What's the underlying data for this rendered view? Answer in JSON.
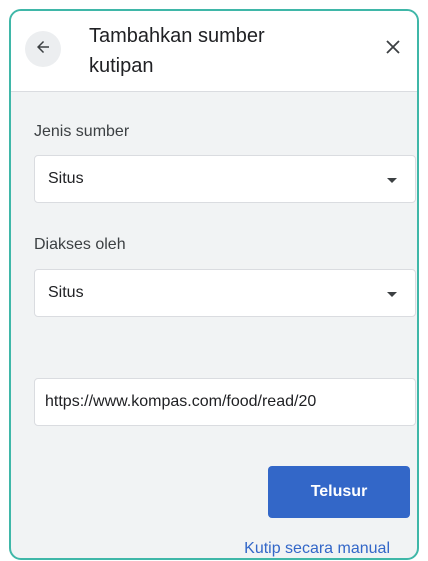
{
  "dialog": {
    "title": "Tambahkan sumber kutipan",
    "icons": {
      "back": "arrow-left-icon",
      "close": "close-icon",
      "dropdown": "caret-down-icon"
    },
    "colors": {
      "accent": "#3367c8",
      "frame_border": "#3fb7a8",
      "panel_bg": "#f1f3f4"
    }
  },
  "source_type": {
    "label": "Jenis sumber",
    "selected": "Situs"
  },
  "accessed_by": {
    "label": "Diakses oleh",
    "selected": "Situs"
  },
  "url_field": {
    "value": "https://www.kompas.com/food/read/20"
  },
  "actions": {
    "search_label": "Telusur",
    "manual_link": "Kutip secara manual"
  }
}
